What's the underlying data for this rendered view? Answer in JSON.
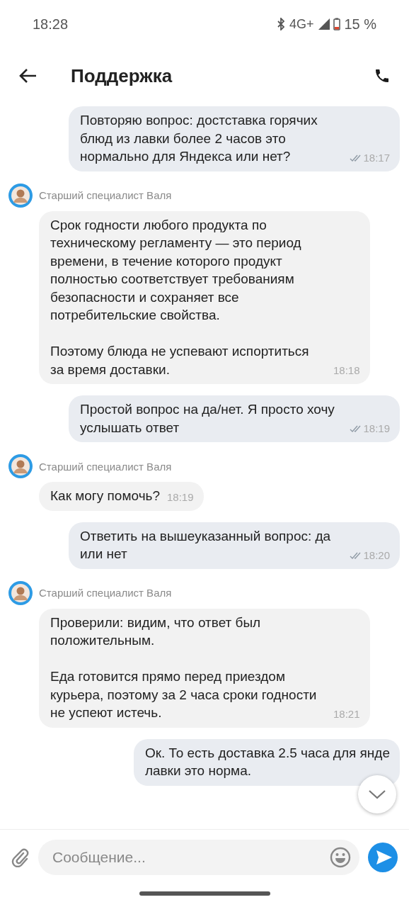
{
  "status_bar": {
    "time": "18:28",
    "network": "4G+",
    "battery": "15 %"
  },
  "header": {
    "title": "Поддержка"
  },
  "messages": [
    {
      "kind": "outgoing",
      "text": "Повторяю вопрос: достставка горячих блюд из лавки более 2 часов это нормально для Яндекса или нет?",
      "time": "18:17",
      "read": true
    },
    {
      "kind": "incoming",
      "sender": "Старший специалист Валя",
      "text": "Срок годности любого продукта по техническому регламенту — это период времени, в течение которого продукт полностью соответствует требованиям безопасности и сохраняет все потребительские свойства.\n\nПоэтому блюда не успевают испортиться за время доставки.",
      "time": "18:18"
    },
    {
      "kind": "outgoing",
      "text": "Простой вопрос на да/нет. Я просто хочу услышать ответ",
      "time": "18:19",
      "read": true
    },
    {
      "kind": "incoming",
      "sender": "Старший специалист Валя",
      "text": "Как могу помочь?",
      "time": "18:19"
    },
    {
      "kind": "outgoing",
      "text": "Ответить на вышеуказанный вопрос: да или нет",
      "time": "18:20",
      "read": true
    },
    {
      "kind": "incoming",
      "sender": "Старший специалист Валя",
      "text": "Проверили: видим, что ответ был положительным.\n\nЕда готовится прямо перед приездом курьера, поэтому за 2 часа сроки годности не успеют истечь.",
      "time": "18:21"
    },
    {
      "kind": "outgoing",
      "text": "Ок. То есть доставка 2.5 часа для янде\nлавки это норма."
    }
  ],
  "composer": {
    "placeholder": "Сообщение..."
  }
}
